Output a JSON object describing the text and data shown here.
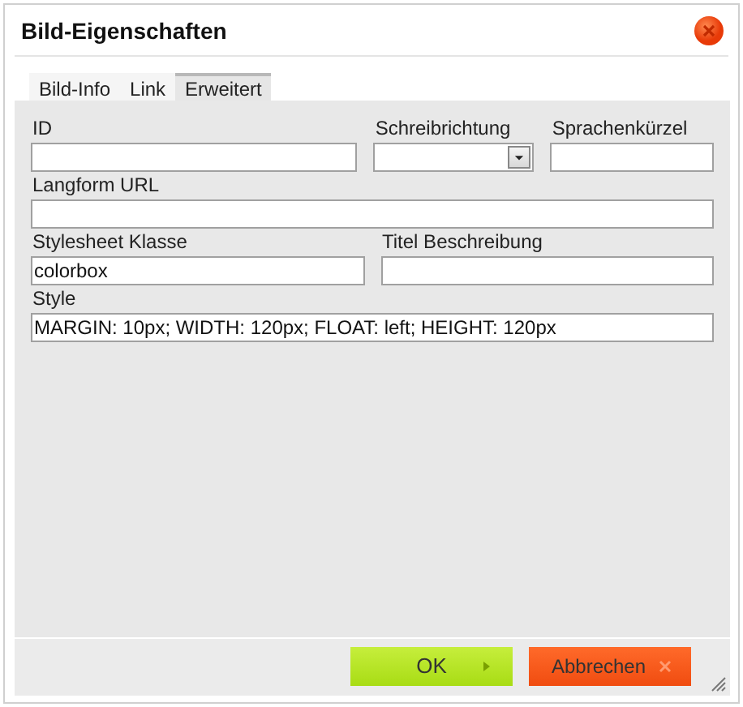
{
  "window": {
    "title": "Bild-Eigenschaften"
  },
  "tabs": [
    {
      "label": "Bild-Info",
      "selected": false
    },
    {
      "label": "Link",
      "selected": false
    },
    {
      "label": "Erweitert",
      "selected": true
    }
  ],
  "rows": [
    [
      {
        "label": "ID",
        "kind": "text"
      },
      {
        "label": "Schreibrichtung",
        "kind": "select"
      },
      {
        "label": "Sprachenkürzel",
        "kind": "text"
      }
    ],
    [
      {
        "label": "Langform URL",
        "kind": "text"
      }
    ],
    [
      {
        "label": "Stylesheet Klasse",
        "kind": "text",
        "value": "colorbox"
      },
      {
        "label": "Titel Beschreibung",
        "kind": "text"
      }
    ],
    [
      {
        "label": "Style",
        "kind": "text",
        "value": "MARGIN: 10px; WIDTH: 120px; FLOAT: left; HEIGHT: 120px"
      }
    ]
  ],
  "buttons": [
    {
      "label": "OK",
      "kind": "ok"
    },
    {
      "label": "Abbrechen",
      "kind": "cancel"
    }
  ]
}
